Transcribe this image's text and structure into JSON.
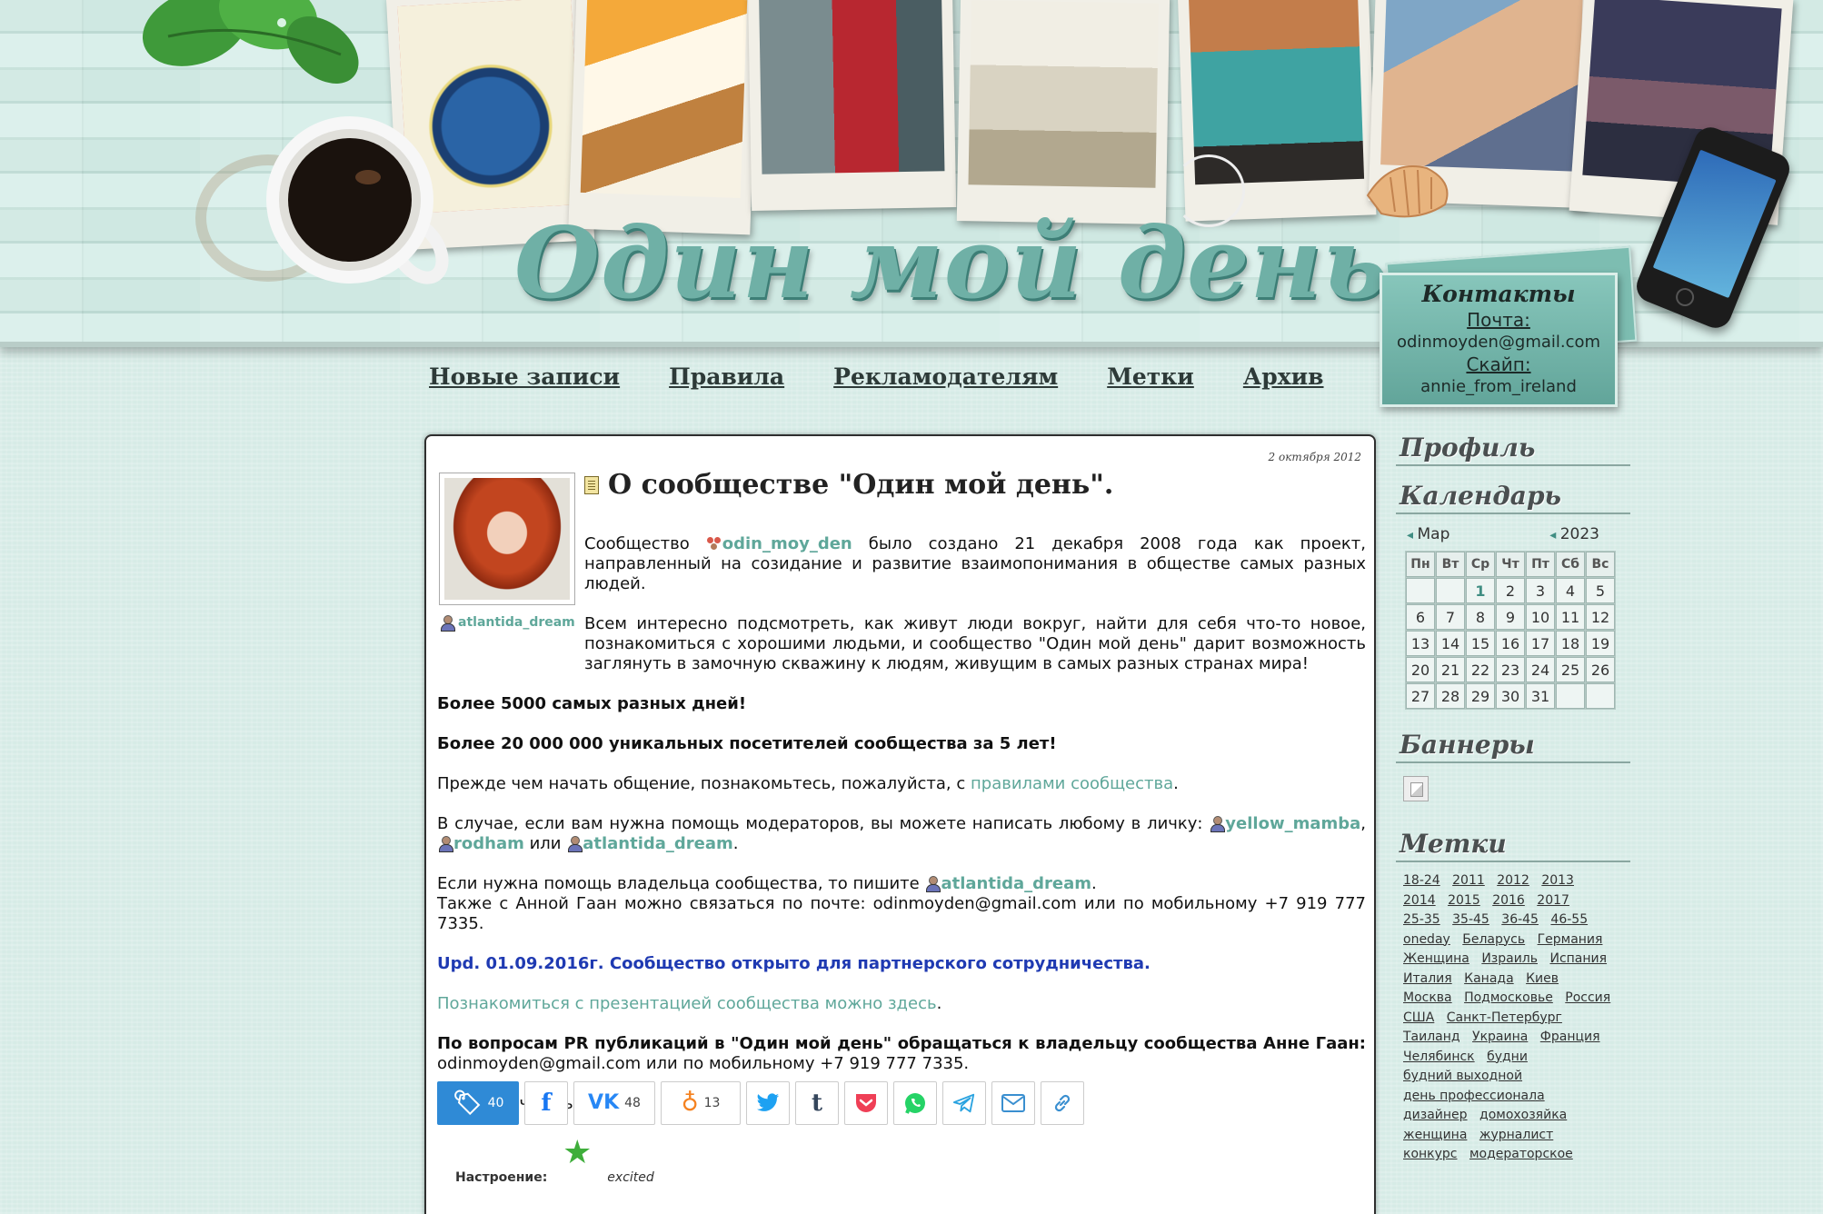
{
  "header": {
    "site_title": "Один мой день",
    "contacts": {
      "title": "Контакты",
      "mail_label": "Почта:",
      "mail_value": "odinmoyden@gmail.com",
      "skype_label": "Скайп:",
      "skype_value": "annie_from_ireland"
    }
  },
  "nav": {
    "items": [
      "Новые записи",
      "Правила",
      "Рекламодателям",
      "Метки",
      "Архив"
    ]
  },
  "post": {
    "date": "2 октября 2012",
    "title": "О сообществе \"Один мой день\".",
    "avatar_user": "atlantida_dream",
    "p1_a": "Сообщество ",
    "p1_community": "odin_moy_den",
    "p1_b": " было создано 21 декабря 2008 года как проект, направленный на созидание и развитие взаимопонимания в обществе самых разных людей.",
    "p2": "Всем интересно подсмотреть, как живут люди вокруг, найти для себя что-то новое, познакомиться с хорошими людьми, и сообщество \"Один мой день\" дарит возможность заглянуть в замочную скважину к людям, живущим в самых разных странах мира!",
    "p3": "Более 5000 самых разных дней!",
    "p4": "Более 20 000 000 уникальных посетителей сообщества за 5 лет!",
    "p5_a": "Прежде чем начать общение, познакомьтесь, пожалуйста, с ",
    "p5_link": "правилами сообщества",
    "p5_b": ".",
    "p6_a": "В случае, если вам нужна помощь модераторов, вы можете написать любому в личку: ",
    "p6_u1": "yellow_mamba",
    "p6_sep": ", ",
    "p6_u2": "rodham",
    "p6_or": " или ",
    "p6_u3": "atlantida_dream",
    "p6_end": ".",
    "p7_a": "Если нужна помощь владельца сообщества, то пишите ",
    "p7_u": "atlantida_dream",
    "p7_b": ".",
    "p7_line2": "Также с Анной Гаан можно связаться по почте: odinmoyden@gmail.com или по мобильному +7 919 777 7335.",
    "p8": "Upd. 01.09.2016г. Сообщество открыто для партнерского сотрудничества.",
    "p9_link": "Познакомиться с презентацией сообщества можно здесь",
    "p9_end": ".",
    "p10_bold": "По вопросам PR публикаций в \"Один мой день\" обращаться к владельцу сообщества Анне Гаан:",
    "p10_rest": " odinmoyden@gmail.com или по мобильному +7 919 777 7335.",
    "p11": "Спасибо, что вы с нами!",
    "share": {
      "main_count": "40",
      "vk_count": "48",
      "ok_count": "13"
    },
    "mood_label": "Настроение:",
    "mood_value": "excited"
  },
  "sidebar": {
    "profile": "Профиль",
    "calendar": "Календарь",
    "cal_month": "Мар",
    "cal_year": "2023",
    "weekdays": [
      "Пн",
      "Вт",
      "Ср",
      "Чт",
      "Пт",
      "Сб",
      "Вс"
    ],
    "weeks": [
      [
        "",
        "",
        "1",
        "2",
        "3",
        "4",
        "5"
      ],
      [
        "6",
        "7",
        "8",
        "9",
        "10",
        "11",
        "12"
      ],
      [
        "13",
        "14",
        "15",
        "16",
        "17",
        "18",
        "19"
      ],
      [
        "20",
        "21",
        "22",
        "23",
        "24",
        "25",
        "26"
      ],
      [
        "27",
        "28",
        "29",
        "30",
        "31",
        "",
        ""
      ]
    ],
    "banners": "Баннеры",
    "tags_head": "Метки",
    "tags": [
      "18-24",
      "2011",
      "2012",
      "2013",
      "2014",
      "2015",
      "2016",
      "2017",
      "25-35",
      "35-45",
      "36-45",
      "46-55",
      "oneday",
      "Беларусь",
      "Германия",
      "Женщина",
      "Израиль",
      "Испания",
      "Италия",
      "Канада",
      "Киев",
      "Москва",
      "Подмосковье",
      "Россия",
      "США",
      "Санкт-Петербург",
      "Таиланд",
      "Украина",
      "Франция",
      "Челябинск",
      "будни",
      "будний выходной",
      "день профессионала",
      "дизайнер",
      "домохозяйка",
      "женщина",
      "журналист",
      "конкурс",
      "модераторское"
    ]
  }
}
